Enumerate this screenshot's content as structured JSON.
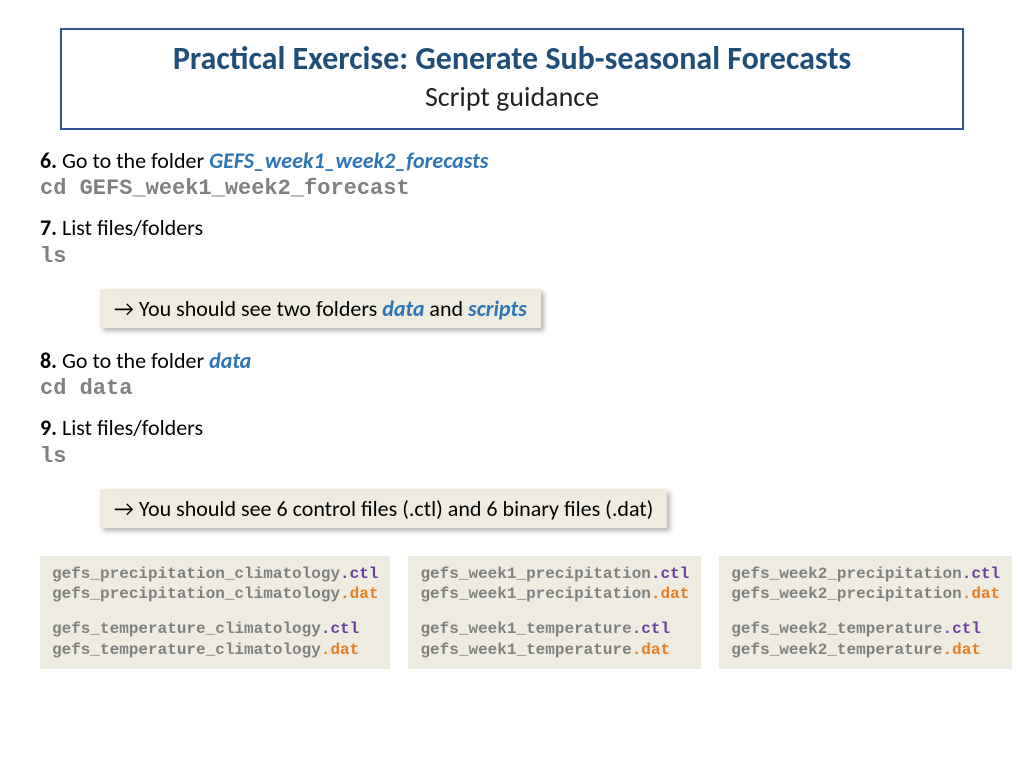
{
  "title": {
    "main": "Practical Exercise: Generate Sub-seasonal Forecasts",
    "sub": "Script guidance"
  },
  "steps": {
    "s6": {
      "num": "6.",
      "text": " Go to the folder ",
      "em": "GEFS_week1_week2_forecasts",
      "cmd": "cd GEFS_week1_week2_forecast"
    },
    "s7": {
      "num": "7.",
      "text": " List files/folders",
      "cmd": "ls"
    },
    "note7": {
      "arrow": "→",
      "t1": " You should see two folders ",
      "em1": "data",
      "t2": " and ",
      "em2": "scripts"
    },
    "s8": {
      "num": "8.",
      "text": " Go to the folder ",
      "em": "data",
      "cmd": "cd data"
    },
    "s9": {
      "num": "9.",
      "text": " List files/folders",
      "cmd": "ls"
    },
    "note9": {
      "arrow": "→",
      "t1": " You should see 6 control files (.ctl) and 6 binary files (.dat)"
    }
  },
  "files": {
    "col1": {
      "l1b": "gefs_precipitation_climatology",
      "l1e": ".ctl",
      "l2b": "gefs_precipitation_climatology",
      "l2e": ".dat",
      "l3b": "gefs_temperature_climatology",
      "l3e": ".ctl",
      "l4b": "gefs_temperature_climatology",
      "l4e": ".dat"
    },
    "col2": {
      "l1b": "gefs_week1_precipitation",
      "l1e": ".ctl",
      "l2b": "gefs_week1_precipitation",
      "l2e": ".dat",
      "l3b": "gefs_week1_temperature",
      "l3e": ".ctl",
      "l4b": "gefs_week1_temperature",
      "l4e": ".dat"
    },
    "col3": {
      "l1b": "gefs_week2_precipitation",
      "l1e": ".ctl",
      "l2b": "gefs_week2_precipitation",
      "l2e": ".dat",
      "l3b": "gefs_week2_temperature",
      "l3e": ".ctl",
      "l4b": "gefs_week2_temperature",
      "l4e": ".dat"
    }
  }
}
